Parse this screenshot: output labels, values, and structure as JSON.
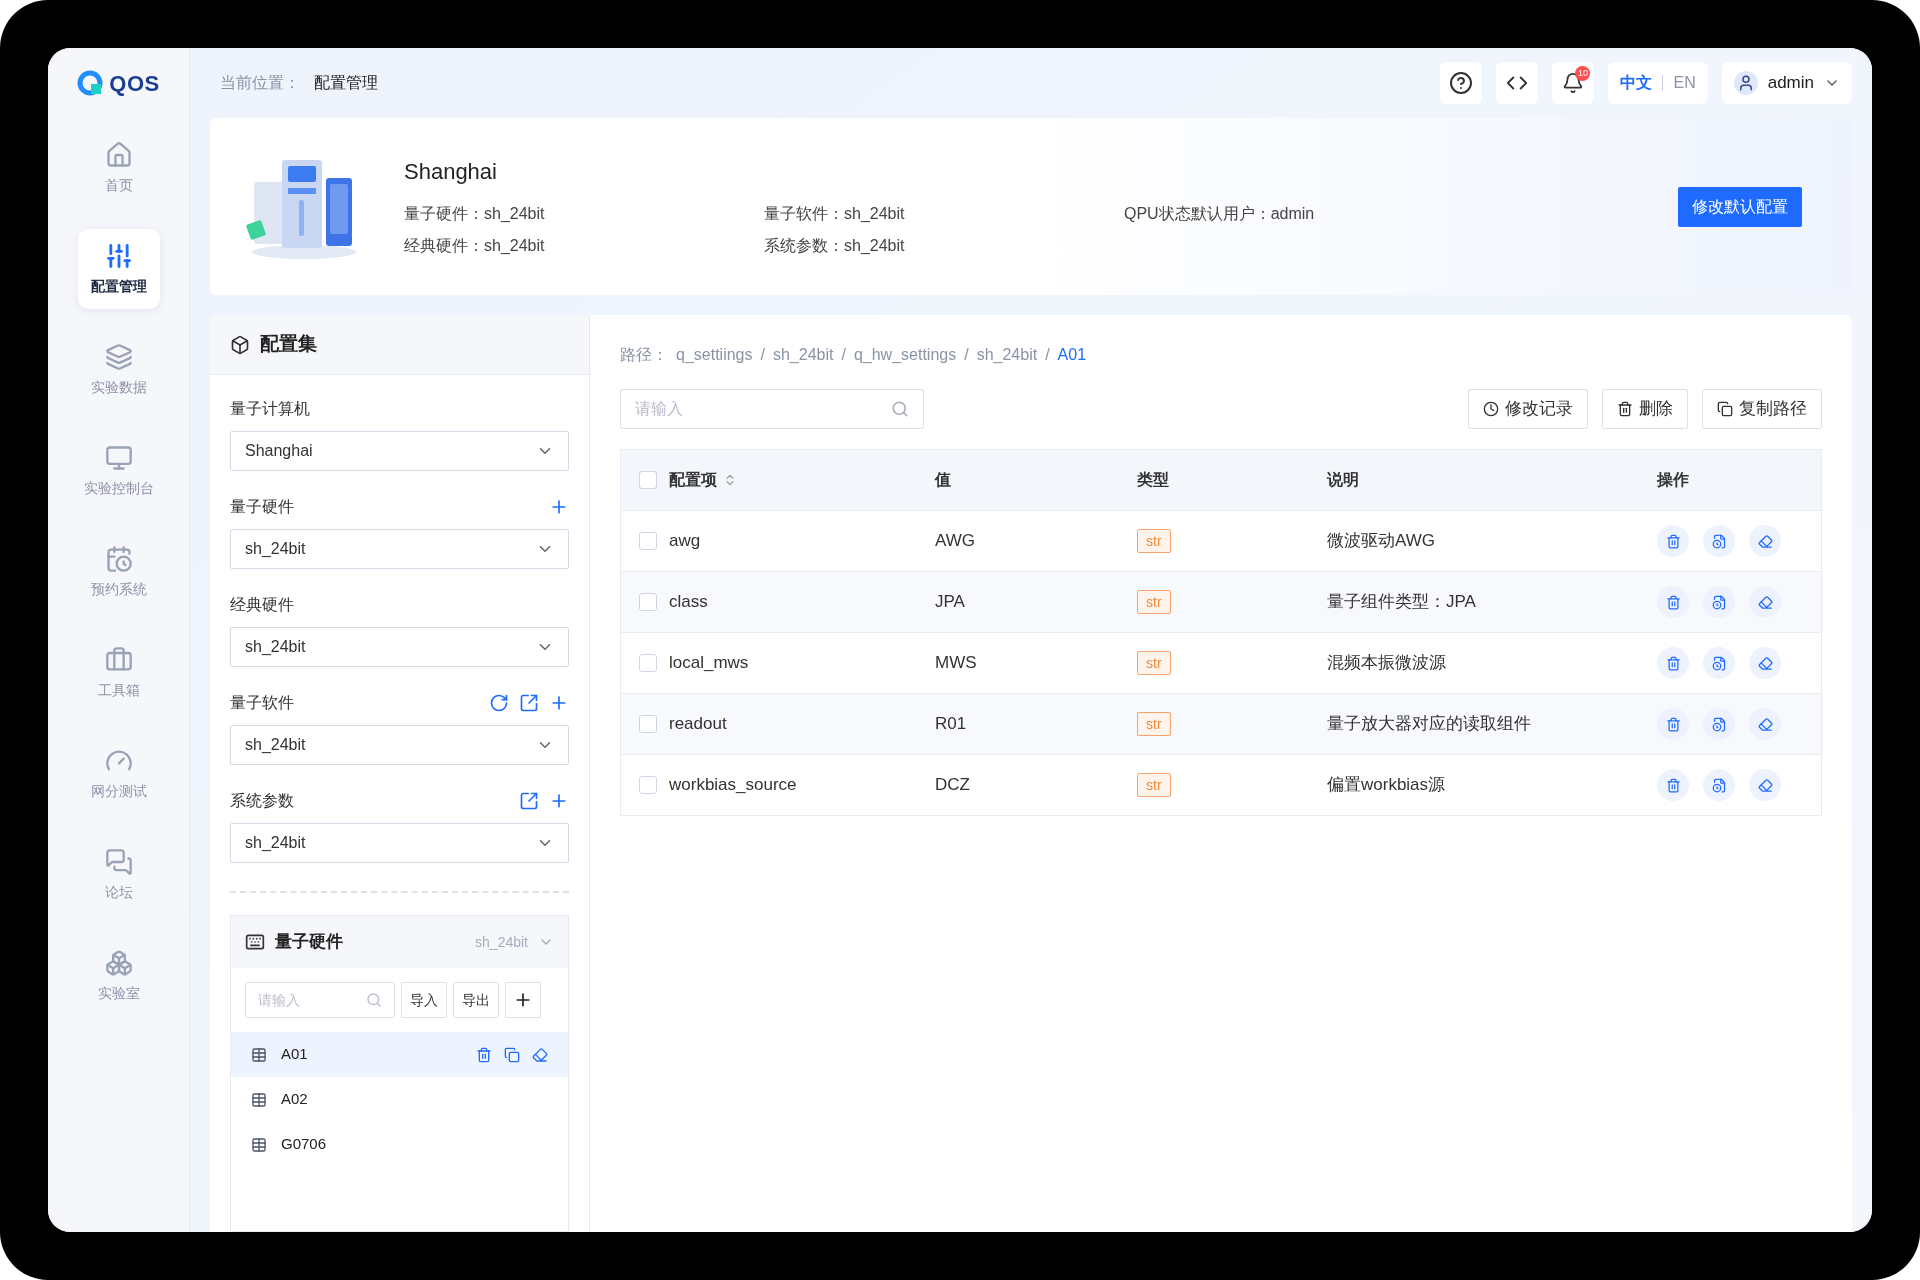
{
  "logo": {
    "text": "QOS"
  },
  "location": {
    "label": "当前位置：",
    "value": "配置管理"
  },
  "header": {
    "notification_count": "10",
    "languages": [
      {
        "label": "中文",
        "selected": true
      },
      {
        "label": "EN",
        "selected": false
      }
    ],
    "user": "admin"
  },
  "sidebar": {
    "items": [
      {
        "kind": "home",
        "label": "首页",
        "selected": false
      },
      {
        "kind": "config",
        "label": "配置管理",
        "selected": true
      },
      {
        "kind": "data",
        "label": "实验数据",
        "selected": false
      },
      {
        "kind": "console",
        "label": "实验控制台",
        "selected": false
      },
      {
        "kind": "booking",
        "label": "预约系统",
        "selected": false
      },
      {
        "kind": "toolbox",
        "label": "工具箱",
        "selected": false
      },
      {
        "kind": "test",
        "label": "网分测试",
        "selected": false
      },
      {
        "kind": "forum",
        "label": "论坛",
        "selected": false
      },
      {
        "kind": "lab",
        "label": "实验室",
        "selected": false
      }
    ]
  },
  "summary": {
    "title": "Shanghai",
    "columns": [
      [
        {
          "label": "量子硬件：",
          "value": "sh_24bit"
        },
        {
          "label": "经典硬件：",
          "value": "sh_24bit"
        }
      ],
      [
        {
          "label": "量子软件：",
          "value": "sh_24bit"
        },
        {
          "label": "系统参数：",
          "value": "sh_24bit"
        }
      ],
      [
        {
          "label": "QPU状态默认用户：",
          "value": "admin"
        }
      ]
    ],
    "button": "修改默认配置"
  },
  "config_panel": {
    "title": "配置集",
    "selectors": [
      {
        "label": "量子计算机",
        "value": "Shanghai"
      },
      {
        "label": "量子硬件",
        "value": "sh_24bit",
        "actions": [
          {
            "kind": "add"
          }
        ]
      },
      {
        "label": "经典硬件",
        "value": "sh_24bit"
      },
      {
        "label": "量子软件",
        "value": "sh_24bit",
        "actions": [
          {
            "kind": "refresh"
          },
          {
            "kind": "open"
          },
          {
            "kind": "add"
          }
        ]
      },
      {
        "label": "系统参数",
        "value": "sh_24bit",
        "actions": [
          {
            "kind": "open"
          },
          {
            "kind": "add"
          }
        ]
      }
    ],
    "tree": {
      "title": "量子硬件",
      "version": "sh_24bit",
      "search_placeholder": "请输入",
      "buttons": [
        "导入",
        "导出"
      ],
      "items": [
        {
          "label": "A01",
          "selected": true
        },
        {
          "label": "A02",
          "selected": false
        },
        {
          "label": "G0706",
          "selected": false
        }
      ]
    }
  },
  "path": {
    "label": "路径：",
    "separator": "/",
    "segments": [
      "q_settiings",
      "sh_24bit",
      "q_hw_settings",
      "sh_24bit",
      "A01"
    ]
  },
  "toolbar": {
    "search_placeholder": "请输入",
    "buttons": [
      {
        "kind": "history",
        "label": "修改记录"
      },
      {
        "kind": "delete",
        "label": "删除"
      },
      {
        "kind": "copy",
        "label": "复制路径"
      }
    ]
  },
  "table": {
    "all_checked": false,
    "columns": [
      {
        "label": "配置项",
        "sortable": true
      },
      {
        "label": "值"
      },
      {
        "label": "类型"
      },
      {
        "label": "说明"
      },
      {
        "label": "操作"
      }
    ],
    "rows": [
      {
        "checked": false,
        "key": "awg",
        "value": "AWG",
        "type": "str",
        "description": "微波驱动AWG"
      },
      {
        "checked": false,
        "key": "class",
        "value": "JPA",
        "type": "str",
        "description": "量子组件类型：JPA"
      },
      {
        "checked": false,
        "key": "local_mws",
        "value": "MWS",
        "type": "str",
        "description": "混频本振微波源"
      },
      {
        "checked": false,
        "key": "readout",
        "value": "R01",
        "type": "str",
        "description": "量子放大器对应的读取组件"
      },
      {
        "checked": false,
        "key": "workbias_source",
        "value": "DCZ",
        "type": "str",
        "description": "偏置workbias源"
      }
    ]
  }
}
